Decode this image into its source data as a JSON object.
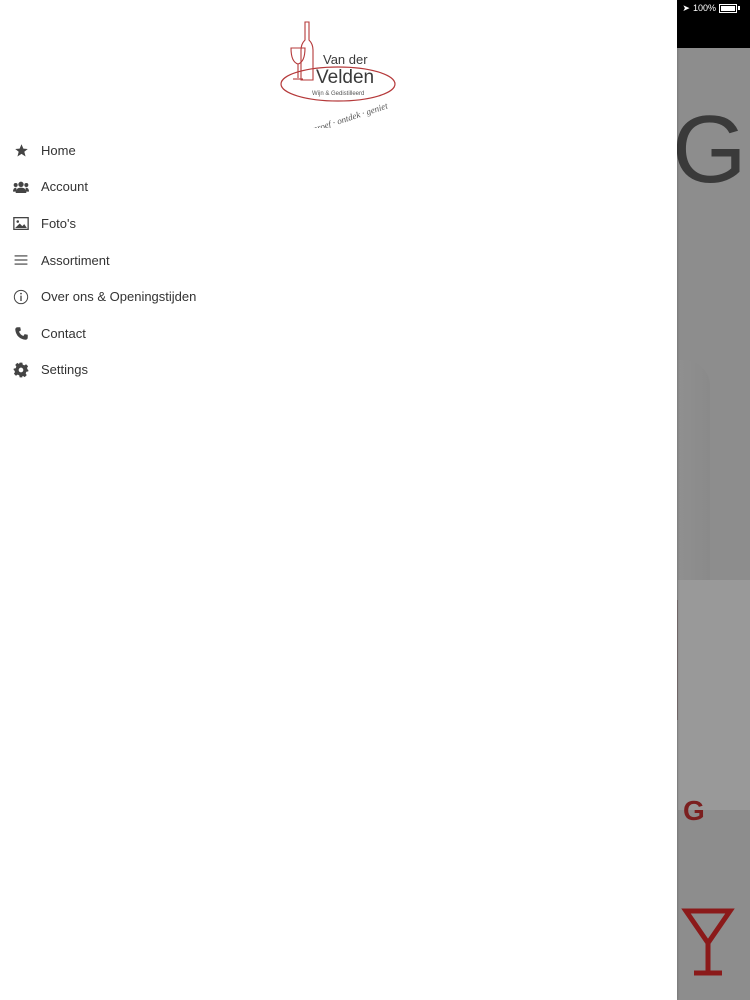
{
  "status_bar": {
    "battery_percent": "100%"
  },
  "logo": {
    "line1": "Van der",
    "line2": "Velden",
    "tagline": "Wijn & Gedistilleerd",
    "slogan": "proef · ontdek · geniet"
  },
  "menu": {
    "items": [
      {
        "label": "Home",
        "icon": "star-icon"
      },
      {
        "label": "Account",
        "icon": "users-icon"
      },
      {
        "label": "Foto's",
        "icon": "image-icon"
      },
      {
        "label": "Assortiment",
        "icon": "list-icon"
      },
      {
        "label": "Over ons & Openingstijden",
        "icon": "info-icon"
      },
      {
        "label": "Contact",
        "icon": "phone-icon"
      },
      {
        "label": "Settings",
        "icon": "gear-icon"
      }
    ]
  },
  "background": {
    "letter": "G",
    "red_text": "G"
  },
  "colors": {
    "logo_red": "#b5393a",
    "logo_text": "#3a3a3a",
    "menu_text": "#333333",
    "icon_color": "#444444"
  }
}
